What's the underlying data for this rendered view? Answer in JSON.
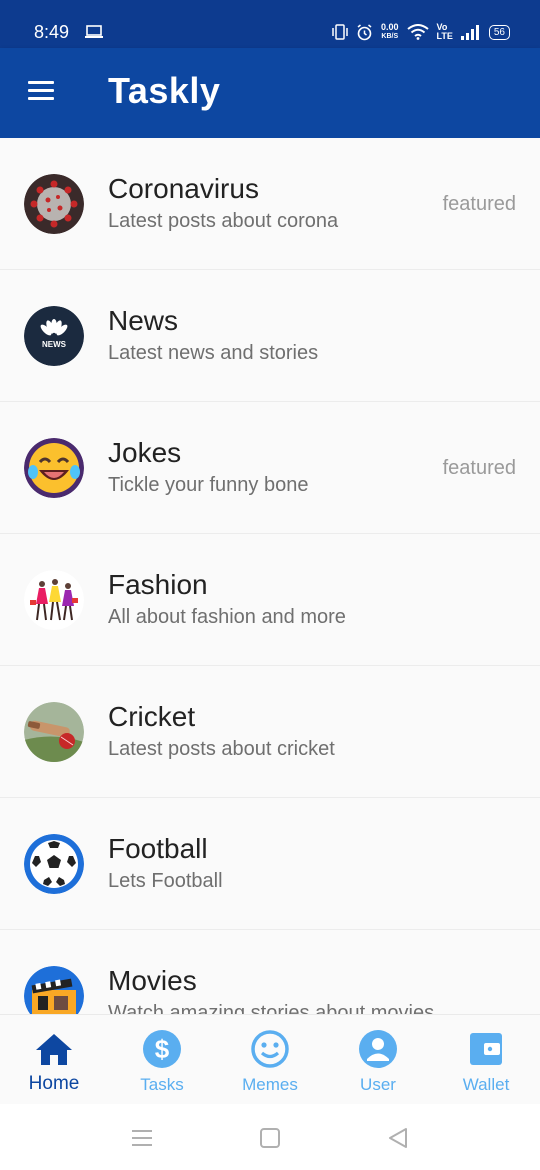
{
  "status_bar": {
    "time": "8:49",
    "net_speed_value": "0.00",
    "net_speed_unit": "KB/S",
    "volte_top": "Vo",
    "volte_bottom": "LTE",
    "battery": "56"
  },
  "app_bar": {
    "title": "Taskly",
    "menu_icon": "hamburger-menu-icon"
  },
  "categories": [
    {
      "name": "Coronavirus",
      "subtitle": "Latest posts about corona",
      "badge": "featured",
      "icon": "coronavirus-avatar"
    },
    {
      "name": "News",
      "subtitle": "Latest news and stories",
      "badge": "",
      "icon": "news-avatar",
      "icon_text": "NEWS"
    },
    {
      "name": "Jokes",
      "subtitle": "Tickle your funny bone",
      "badge": "featured",
      "icon": "laughing-emoji-avatar"
    },
    {
      "name": "Fashion",
      "subtitle": "All about fashion and more",
      "badge": "",
      "icon": "fashion-avatar"
    },
    {
      "name": "Cricket",
      "subtitle": "Latest posts about cricket",
      "badge": "",
      "icon": "cricket-avatar"
    },
    {
      "name": "Football",
      "subtitle": "Lets Football",
      "badge": "",
      "icon": "football-avatar"
    },
    {
      "name": "Movies",
      "subtitle": "Watch amazing stories about movies",
      "badge": "",
      "icon": "movies-avatar"
    }
  ],
  "bottom_nav": {
    "active": "Home",
    "items": [
      {
        "label": "Home",
        "icon": "home-icon"
      },
      {
        "label": "Tasks",
        "icon": "dollar-icon"
      },
      {
        "label": "Memes",
        "icon": "smiley-icon"
      },
      {
        "label": "User",
        "icon": "user-icon"
      },
      {
        "label": "Wallet",
        "icon": "wallet-icon"
      }
    ]
  },
  "colors": {
    "status_bar": "#0d3b8f",
    "app_bar": "#0d47a1",
    "nav_active": "#0d47a1",
    "nav_inactive": "#5aaef0"
  }
}
